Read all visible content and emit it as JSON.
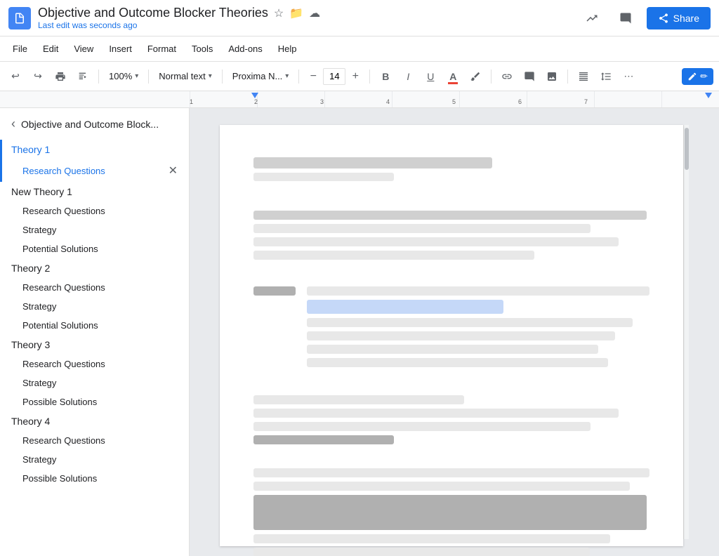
{
  "app": {
    "doc_icon_color": "#4285f4",
    "title": "Objective and Outcome Blocker Theories",
    "last_edit": "Last edit was seconds ago",
    "share_label": "Share"
  },
  "menu": {
    "items": [
      "File",
      "Edit",
      "View",
      "Insert",
      "Format",
      "Tools",
      "Add-ons",
      "Help"
    ]
  },
  "toolbar": {
    "undo": "↩",
    "redo": "↪",
    "print": "🖨",
    "paint_format": "🎨",
    "zoom": "100%",
    "style_label": "Normal text",
    "style_arrow": "▾",
    "font_label": "Proxima N...",
    "font_arrow": "▾",
    "font_size": "14",
    "bold": "B",
    "italic": "I",
    "underline": "U",
    "font_color": "A",
    "highlight": "✏",
    "link": "🔗",
    "comment": "💬",
    "image": "🖼",
    "align": "≡",
    "line_spacing": "↕",
    "more": "⋯",
    "pencil_label": "✏"
  },
  "sidebar": {
    "back_label": "‹",
    "doc_title": "Objective and Outcome Block...",
    "items": [
      {
        "label": "Theory 1",
        "level": "top",
        "active": true,
        "id": "theory-1"
      },
      {
        "label": "Research Questions",
        "level": "sub",
        "active": true,
        "has_close": true,
        "id": "research-questions-1"
      },
      {
        "label": "New Theory 1",
        "level": "top",
        "active": false,
        "id": "new-theory-1"
      },
      {
        "label": "Research Questions",
        "level": "sub",
        "active": false,
        "id": "research-questions-nt1"
      },
      {
        "label": "Strategy",
        "level": "sub",
        "active": false,
        "id": "strategy-nt1"
      },
      {
        "label": "Potential Solutions",
        "level": "sub",
        "active": false,
        "id": "potential-solutions-nt1"
      },
      {
        "label": "Theory 2",
        "level": "top",
        "active": false,
        "id": "theory-2"
      },
      {
        "label": "Research Questions",
        "level": "sub",
        "active": false,
        "id": "research-questions-2"
      },
      {
        "label": "Strategy",
        "level": "sub",
        "active": false,
        "id": "strategy-2"
      },
      {
        "label": "Potential Solutions",
        "level": "sub",
        "active": false,
        "id": "potential-solutions-2"
      },
      {
        "label": "Theory 3",
        "level": "top",
        "active": false,
        "id": "theory-3"
      },
      {
        "label": "Research Questions",
        "level": "sub",
        "active": false,
        "id": "research-questions-3"
      },
      {
        "label": "Strategy",
        "level": "sub",
        "active": false,
        "id": "strategy-3"
      },
      {
        "label": "Possible Solutions",
        "level": "sub",
        "active": false,
        "id": "possible-solutions-3"
      },
      {
        "label": "Theory 4",
        "level": "top",
        "active": false,
        "id": "theory-4"
      },
      {
        "label": "Research Questions",
        "level": "sub",
        "active": false,
        "id": "research-questions-4"
      },
      {
        "label": "Strategy",
        "level": "sub",
        "active": false,
        "id": "strategy-4"
      },
      {
        "label": "Possible Solutions",
        "level": "sub",
        "active": false,
        "id": "possible-solutions-4"
      }
    ]
  },
  "document": {
    "sections": []
  }
}
